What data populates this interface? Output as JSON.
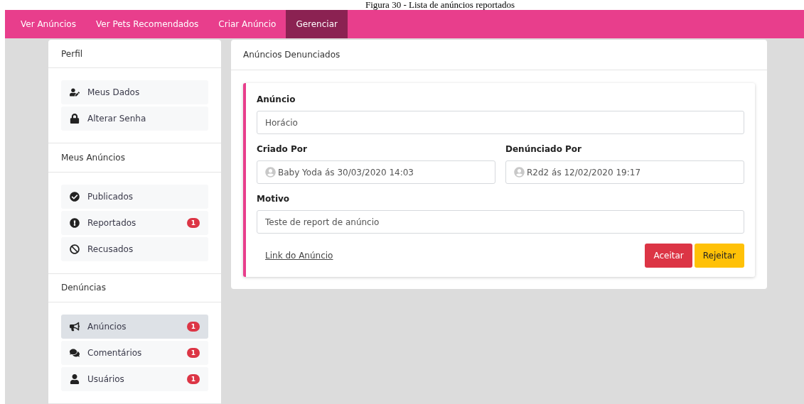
{
  "caption": "Figura 30 - Lista de anúncios reportados",
  "nav": [
    {
      "label": "Ver Anúncios",
      "selected": false
    },
    {
      "label": "Ver Pets Recomendados",
      "selected": false
    },
    {
      "label": "Criar Anúncio",
      "selected": false
    },
    {
      "label": "Gerenciar",
      "selected": true
    }
  ],
  "sidebar": [
    {
      "title": "Perfil",
      "items": [
        {
          "label": "Meus Dados",
          "selected": false
        },
        {
          "label": "Alterar Senha",
          "selected": false
        }
      ]
    },
    {
      "title": "Meus Anúncios",
      "items": [
        {
          "label": "Publicados",
          "selected": false
        },
        {
          "label": "Reportados",
          "selected": false,
          "badge": "1"
        },
        {
          "label": "Recusados",
          "selected": false
        }
      ]
    },
    {
      "title": "Denúncias",
      "items": [
        {
          "label": "Anúncios",
          "selected": true,
          "badge": "1"
        },
        {
          "label": "Comentários",
          "selected": false,
          "badge": "1"
        },
        {
          "label": "Usuários",
          "selected": false,
          "badge": "1"
        }
      ]
    }
  ],
  "panel": {
    "title": "Anúncios Denunciados",
    "report": {
      "ad_label": "Anúncio",
      "ad_value": "Horácio",
      "created_label": "Criado Por",
      "created_value": "Baby Yoda ás 30/03/2020 14:03",
      "reported_label": "Denúnciado Por",
      "reported_value": "R2d2 ás 12/02/2020 19:17",
      "reason_label": "Motivo",
      "reason_value": "Teste de report de anúncio",
      "link": "Link do Anúncio",
      "buttons": [
        {
          "label": "Aceitar",
          "kind": "danger"
        },
        {
          "label": "Rejeitar",
          "kind": "warning"
        }
      ]
    }
  }
}
